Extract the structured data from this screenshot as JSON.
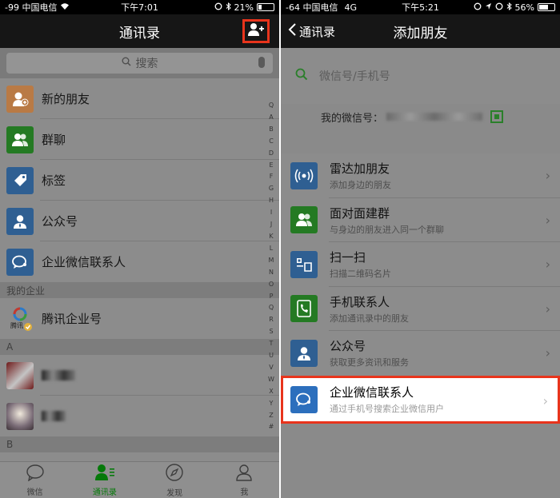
{
  "left": {
    "status": {
      "carrier": "-99 中国电信",
      "time": "下午7:01",
      "battery": "21%",
      "battery_level": 0.21
    },
    "nav": {
      "title": "通讯录"
    },
    "search": {
      "placeholder": "搜索"
    },
    "items": [
      {
        "label": "新的朋友",
        "icon": "add-friend-icon",
        "color": "#f08a3c"
      },
      {
        "label": "群聊",
        "icon": "group-icon",
        "color": "#1aad19"
      },
      {
        "label": "标签",
        "icon": "tag-icon",
        "color": "#2c6fbd"
      },
      {
        "label": "公众号",
        "icon": "official-account-icon",
        "color": "#2c6fbd"
      },
      {
        "label": "企业微信联系人",
        "icon": "wecom-icon",
        "color": "#2c6fbd"
      }
    ],
    "section_enterprise": "我的企业",
    "enterprise_item": "腾讯企业号",
    "enterprise_logo_text": "腾讯",
    "section_a": "A",
    "section_b": "B",
    "index": [
      "Q",
      "A",
      "B",
      "C",
      "D",
      "E",
      "F",
      "G",
      "H",
      "I",
      "J",
      "K",
      "L",
      "M",
      "N",
      "O",
      "P",
      "Q",
      "R",
      "S",
      "T",
      "U",
      "V",
      "W",
      "X",
      "Y",
      "Z",
      "#"
    ],
    "tabs": [
      {
        "label": "微信",
        "icon": "chat-icon"
      },
      {
        "label": "通讯录",
        "icon": "contacts-icon",
        "active": true
      },
      {
        "label": "发现",
        "icon": "compass-icon"
      },
      {
        "label": "我",
        "icon": "me-icon"
      }
    ]
  },
  "right": {
    "status": {
      "carrier": "-64 中国电信",
      "network": "4G",
      "time": "下午5:21",
      "battery": "56%",
      "battery_level": 0.56
    },
    "nav": {
      "title": "添加朋友",
      "back": "通讯录"
    },
    "search": {
      "placeholder": "微信号/手机号"
    },
    "my_id_label": "我的微信号：",
    "items": [
      {
        "title": "雷达加朋友",
        "subtitle": "添加身边的朋友",
        "icon": "radar-icon"
      },
      {
        "title": "面对面建群",
        "subtitle": "与身边的朋友进入同一个群聊",
        "icon": "face-group-icon"
      },
      {
        "title": "扫一扫",
        "subtitle": "扫描二维码名片",
        "icon": "scan-icon"
      },
      {
        "title": "手机联系人",
        "subtitle": "添加通讯录中的朋友",
        "icon": "phone-contacts-icon"
      },
      {
        "title": "公众号",
        "subtitle": "获取更多资讯和服务",
        "icon": "official-account-icon"
      },
      {
        "title": "企业微信联系人",
        "subtitle": "通过手机号搜索企业微信用户",
        "icon": "wecom-icon"
      }
    ]
  }
}
